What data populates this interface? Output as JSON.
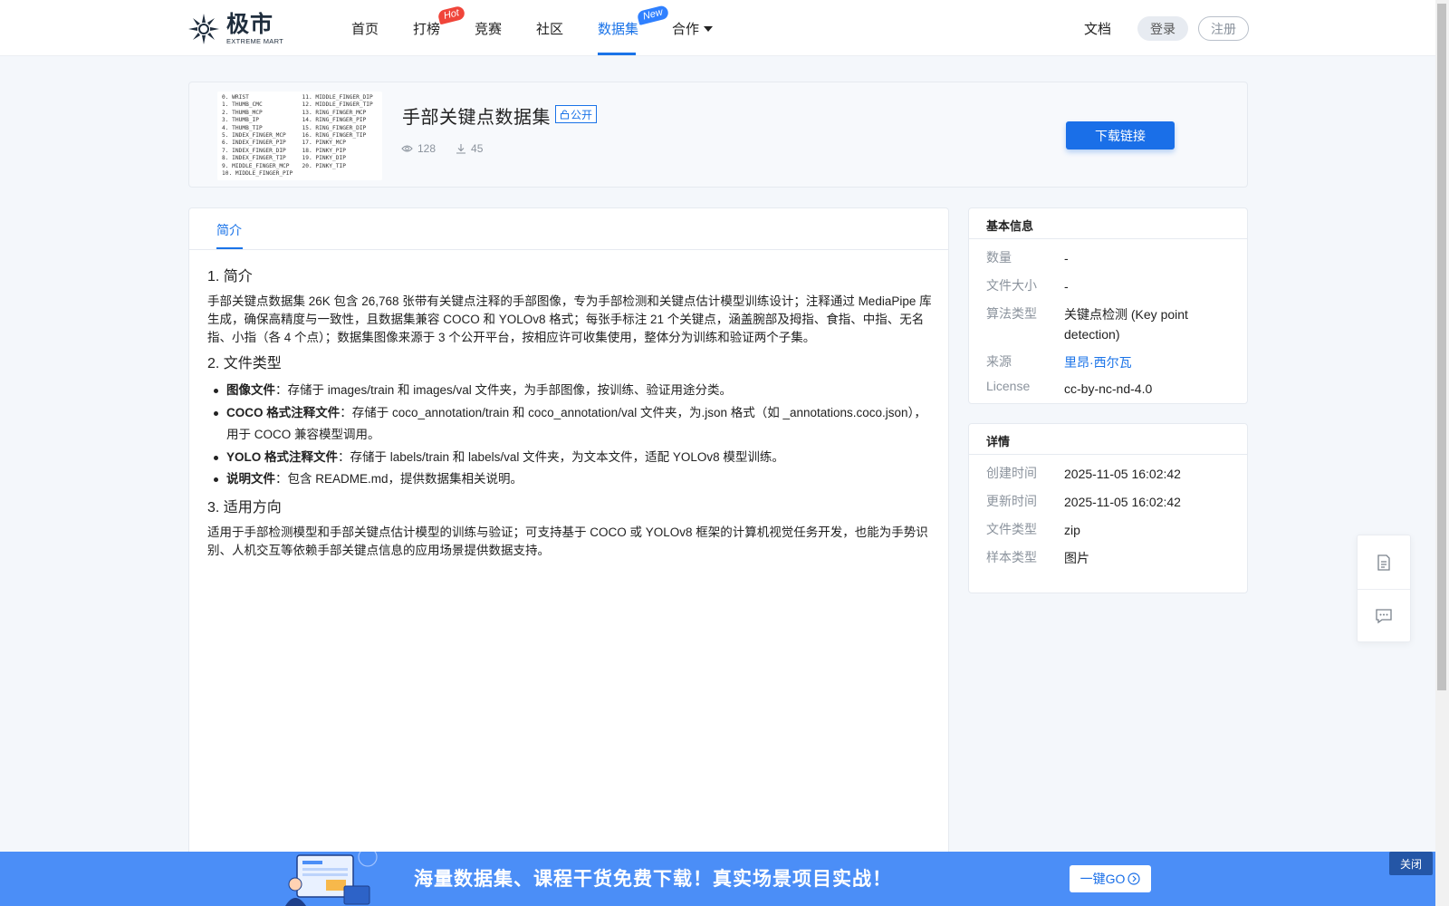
{
  "header": {
    "logo": {
      "cn": "极市",
      "en": "EXTREME MART"
    },
    "nav": [
      {
        "label": "首页"
      },
      {
        "label": "打榜",
        "badge": "Hot"
      },
      {
        "label": "竞赛"
      },
      {
        "label": "社区"
      },
      {
        "label": "数据集",
        "badge": "New",
        "active": true
      },
      {
        "label": "合作",
        "dropdown": true
      }
    ],
    "docs": "文档",
    "login": "登录",
    "register": "注册"
  },
  "dataset": {
    "title": "手部关键点数据集",
    "tag": "公开",
    "views": "128",
    "downloads": "45",
    "download_button": "下载链接",
    "thumbnail_lines_left": [
      "0. WRIST",
      "1. THUMB_CMC",
      "2. THUMB_MCP",
      "3. THUMB_IP",
      "4. THUMB_TIP",
      "5. INDEX_FINGER_MCP",
      "6. INDEX_FINGER_PIP",
      "7. INDEX_FINGER_DIP",
      "8. INDEX_FINGER_TIP",
      "9. MIDDLE_FINGER_MCP",
      "10. MIDDLE_FINGER_PIP"
    ],
    "thumbnail_lines_right": [
      "11. MIDDLE_FINGER_DIP",
      "12. MIDDLE_FINGER_TIP",
      "13. RING_FINGER_MCP",
      "14. RING_FINGER_PIP",
      "15. RING_FINGER_DIP",
      "16. RING_FINGER_TIP",
      "17. PINKY_MCP",
      "18. PINKY_PIP",
      "19. PINKY_DIP",
      "20. PINKY_TIP"
    ]
  },
  "tabs": {
    "intro": "简介"
  },
  "content": {
    "h1": "1. 简介",
    "p1": "手部关键点数据集 26K 包含 26,768 张带有关键点注释的手部图像，专为手部检测和关键点估计模型训练设计；注释通过 MediaPipe 库生成，确保高精度与一致性，且数据集兼容 COCO 和 YOLOv8 格式；每张手标注 21 个关键点，涵盖腕部及拇指、食指、中指、无名指、小指（各 4 个点）；数据集图像来源于 3 个公开平台，按相应许可收集使用，整体分为训练和验证两个子集。",
    "h2": "2. 文件类型",
    "items": [
      {
        "bold": "图像文件",
        "text": "：存储于 images/train 和 images/val 文件夹，为手部图像，按训练、验证用途分类。"
      },
      {
        "bold": "COCO 格式注释文件",
        "text": "：存储于 coco_annotation/train 和 coco_annotation/val 文件夹，为.json 格式（如 _annotations.coco.json），用于 COCO 兼容模型调用。"
      },
      {
        "bold": "YOLO 格式注释文件",
        "text": "：存储于 labels/train 和 labels/val 文件夹，为文本文件，适配 YOLOv8 模型训练。"
      },
      {
        "bold": "说明文件",
        "text": "：包含 README.md，提供数据集相关说明。"
      }
    ],
    "h3": "3. 适用方向",
    "p3": "适用于手部检测模型和手部关键点估计模型的训练与验证；可支持基于 COCO 或 YOLOv8 框架的计算机视觉任务开发，也能为手势识别、人机交互等依赖手部关键点信息的应用场景提供数据支持。"
  },
  "basic_info": {
    "title": "基本信息",
    "rows": [
      {
        "k": "数量",
        "v": "-"
      },
      {
        "k": "文件大小",
        "v": "-"
      },
      {
        "k": "算法类型",
        "v": "关键点检测 (Key point detection)"
      },
      {
        "k": "来源",
        "v": "里昂·西尔瓦"
      },
      {
        "k": "License",
        "v": "cc-by-nc-nd-4.0"
      }
    ]
  },
  "details": {
    "title": "详情",
    "rows": [
      {
        "k": "创建时间",
        "v": "2025-11-05 16:02:42"
      },
      {
        "k": "更新时间",
        "v": "2025-11-05 16:02:42"
      },
      {
        "k": "文件类型",
        "v": "zip"
      },
      {
        "k": "样本类型",
        "v": "图片"
      }
    ]
  },
  "floating_tools": [
    "document-icon",
    "message-icon"
  ],
  "banner": {
    "text": "海量数据集、课程干货免费下载！真实场景项目实战！",
    "button": "一键GO",
    "close": "关闭"
  },
  "colors": {
    "accent": "#1a73e8",
    "hot": "#f0453a",
    "new": "#2f80ff",
    "banner": "#4b8ef7"
  }
}
